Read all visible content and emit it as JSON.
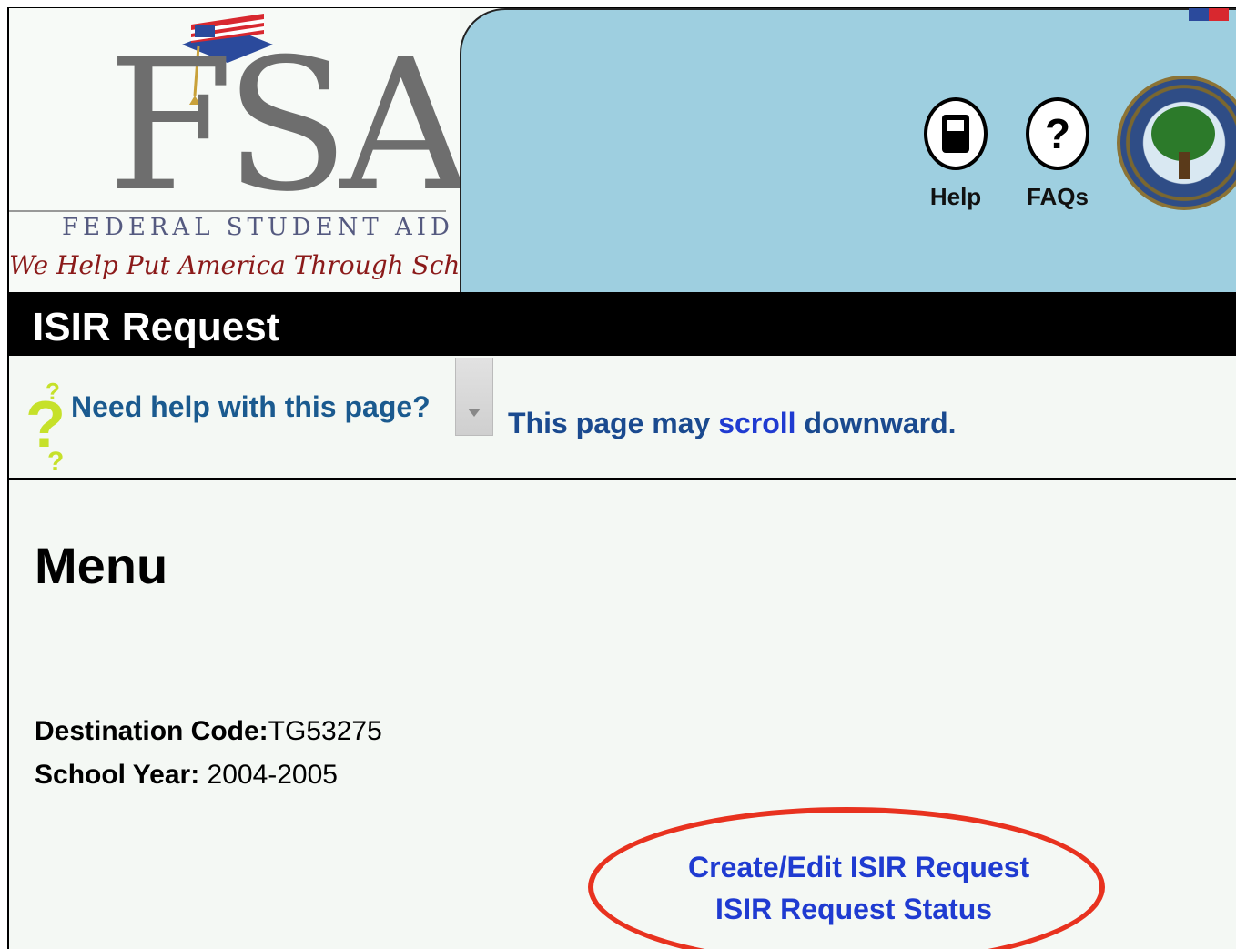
{
  "header": {
    "logo_letters": "FSA",
    "logo_name": "FEDERAL STUDENT AID",
    "logo_tagline": "We Help Put America Through School",
    "help_label": "Help",
    "faqs_label": "FAQs"
  },
  "title_bar": {
    "title": "ISIR Request"
  },
  "help_row": {
    "help_link": "Need help with this page?",
    "scroll_prefix": "This page may ",
    "scroll_word": "scroll",
    "scroll_suffix": " downward."
  },
  "content": {
    "menu_title": "Menu",
    "destination_label": "Destination Code:",
    "destination_value": "TG53275",
    "school_year_label": "School Year:",
    "school_year_value": " 2004-2005",
    "links": {
      "create_edit": "Create/Edit ISIR Request",
      "status": "ISIR Request Status"
    }
  },
  "colors": {
    "link_blue": "#1f3bd1",
    "highlight_oval": "#e8321f",
    "header_panel": "#9ecfe0"
  }
}
